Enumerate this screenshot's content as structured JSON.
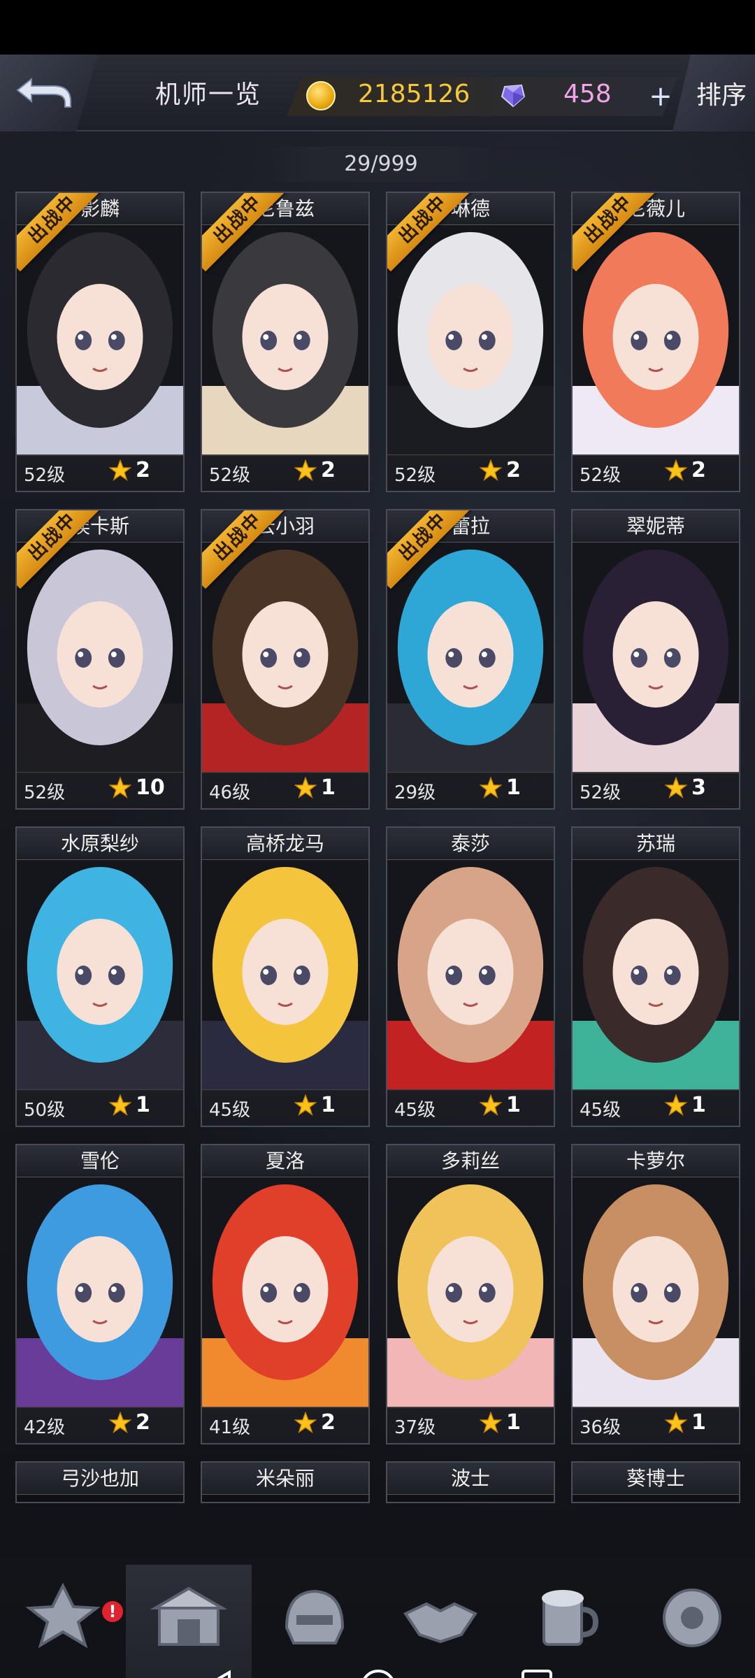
{
  "header": {
    "title": "机师一览",
    "coins": "2185126",
    "gems": "458",
    "plus_label": "+",
    "sort_label": "排序"
  },
  "collection_count": "29/999",
  "deploy_badge": "出战中",
  "characters": [
    {
      "name": "影麟",
      "level": "52级",
      "stars": "2",
      "deployed": true,
      "hair": "#2a2a30",
      "accent": "#c9c9dc"
    },
    {
      "name": "尼鲁兹",
      "level": "52级",
      "stars": "2",
      "deployed": true,
      "hair": "#3a3a3e",
      "accent": "#e7d7bf"
    },
    {
      "name": "琳德",
      "level": "52级",
      "stars": "2",
      "deployed": true,
      "hair": "#e6e6ea",
      "accent": "#1b1b22"
    },
    {
      "name": "尼薇儿",
      "level": "52级",
      "stars": "2",
      "deployed": true,
      "hair": "#f07a5a",
      "accent": "#efe8f5"
    },
    {
      "name": "埃卡斯",
      "level": "52级",
      "stars": "10",
      "deployed": true,
      "hair": "#c9c6d8",
      "accent": "#1d1d22"
    },
    {
      "name": "云小羽",
      "level": "46级",
      "stars": "1",
      "deployed": true,
      "hair": "#4a3426",
      "accent": "#b52424"
    },
    {
      "name": "蕾拉",
      "level": "29级",
      "stars": "1",
      "deployed": true,
      "hair": "#2ea6d6",
      "accent": "#2a2b33"
    },
    {
      "name": "翠妮蒂",
      "level": "52级",
      "stars": "3",
      "deployed": false,
      "hair": "#2a2036",
      "accent": "#e7d3d8"
    },
    {
      "name": "水原梨纱",
      "level": "50级",
      "stars": "1",
      "deployed": false,
      "hair": "#3fb4e2",
      "accent": "#2c2c3a"
    },
    {
      "name": "高桥龙马",
      "level": "45级",
      "stars": "1",
      "deployed": false,
      "hair": "#f4c43c",
      "accent": "#2a2a40"
    },
    {
      "name": "泰莎",
      "level": "45级",
      "stars": "1",
      "deployed": false,
      "hair": "#d7a488",
      "accent": "#c22222"
    },
    {
      "name": "苏瑞",
      "level": "45级",
      "stars": "1",
      "deployed": false,
      "hair": "#3a2a2a",
      "accent": "#3fb39a"
    },
    {
      "name": "雪伦",
      "level": "42级",
      "stars": "2",
      "deployed": false,
      "hair": "#3f9be0",
      "accent": "#6a3c9a"
    },
    {
      "name": "夏洛",
      "level": "41级",
      "stars": "2",
      "deployed": false,
      "hair": "#e0402a",
      "accent": "#ef8a2e"
    },
    {
      "name": "多莉丝",
      "level": "37级",
      "stars": "1",
      "deployed": false,
      "hair": "#f0c25a",
      "accent": "#f3b6b6"
    },
    {
      "name": "卡萝尔",
      "level": "36级",
      "stars": "1",
      "deployed": false,
      "hair": "#c89062",
      "accent": "#e9e4ef"
    }
  ],
  "partial_row": [
    "弓沙也加",
    "米朵丽",
    "波士",
    "葵博士"
  ],
  "nav": [
    {
      "label": "基地",
      "icon": "base-emblem-icon",
      "badge": "!"
    },
    {
      "label": "仓库",
      "icon": "warehouse-icon",
      "active": true
    },
    {
      "label": "编队",
      "icon": "formation-helmet-icon"
    },
    {
      "label": "社交",
      "icon": "handshake-icon"
    },
    {
      "label": "酒馆",
      "icon": "tavern-mug-icon"
    },
    {
      "label": "商城",
      "icon": "shop-orb-icon"
    }
  ],
  "colors": {
    "gold": "#f5c93b",
    "gem": "#f3a4e6",
    "ribbon": "#f2b431"
  }
}
